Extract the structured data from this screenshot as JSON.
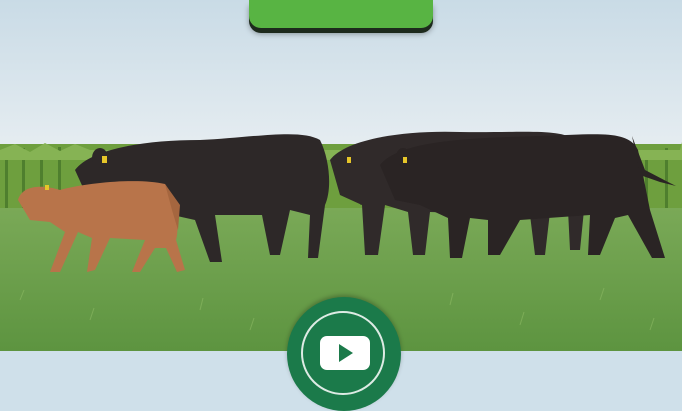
{
  "page": {
    "background": "#cfe0ea"
  },
  "scene": {
    "subject": "cattle-herd-walking-in-pasture",
    "animals": [
      {
        "name": "calf",
        "color": "#b8744a"
      },
      {
        "name": "black-cow",
        "color": "#2d2828"
      },
      {
        "name": "black-cow",
        "color": "#2d2828"
      },
      {
        "name": "black-cow",
        "color": "#2d2828"
      }
    ]
  },
  "top_button": {
    "label": "",
    "color": "#58b443"
  },
  "play_button": {
    "icon": "play-icon",
    "color": "#1b7a4a"
  },
  "colors": {
    "top_bar": "#1e3a1e",
    "grass": "#6fa04b",
    "sky": "#dde8ef",
    "corn": "#6e9f3e"
  }
}
